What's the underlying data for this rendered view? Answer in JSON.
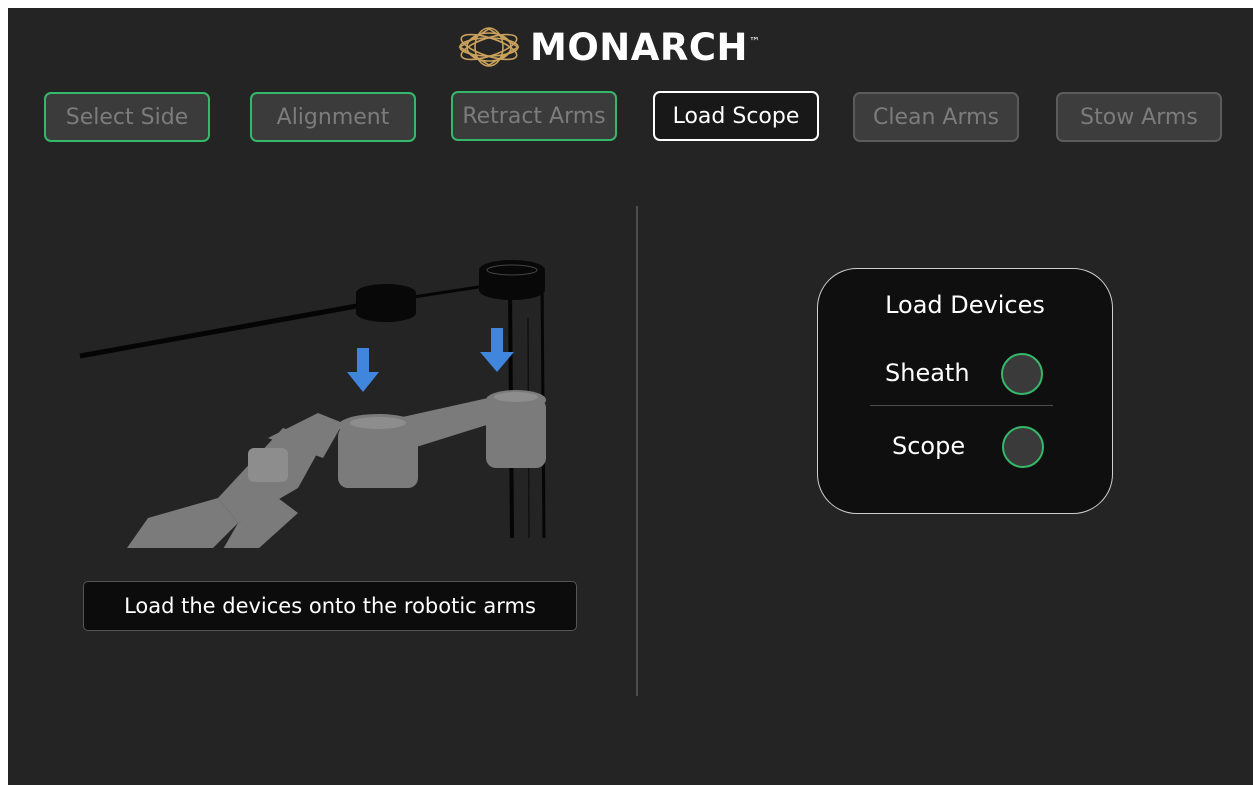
{
  "brand": {
    "name": "MONARCH",
    "trademark": "™",
    "logo_icon": "monarch-logo-icon",
    "logo_color": "#c9a15c"
  },
  "steps": [
    {
      "label": "Select Side",
      "state": "done"
    },
    {
      "label": "Alignment",
      "state": "done"
    },
    {
      "label": "Retract Arms",
      "state": "done"
    },
    {
      "label": "Load Scope",
      "state": "active"
    },
    {
      "label": "Clean Arms",
      "state": "pending"
    },
    {
      "label": "Stow Arms",
      "state": "pending"
    }
  ],
  "illustration": {
    "icon": "robotic-arms-loading-illustration",
    "arrow_color": "#3f86dc"
  },
  "instruction": "Load the devices onto the robotic arms",
  "devices_panel": {
    "title": "Load Devices",
    "devices": [
      {
        "label": "Sheath",
        "loaded": false
      },
      {
        "label": "Scope",
        "loaded": false
      }
    ]
  },
  "colors": {
    "background": "#242424",
    "done_border": "#34b86a",
    "active_border": "#ffffff",
    "indicator_ring": "#34b86a"
  }
}
